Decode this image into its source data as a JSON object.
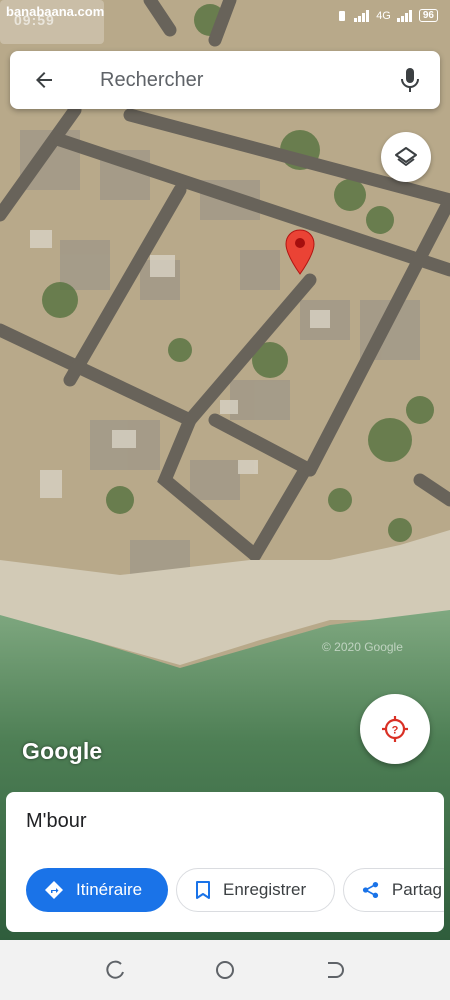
{
  "status_bar": {
    "time": "09:59",
    "network": "4G",
    "battery": "96",
    "watermark": "banabaana.com"
  },
  "search": {
    "placeholder": "Rechercher"
  },
  "map": {
    "copyright": "© 2020 Google",
    "logo": "Google",
    "icons": [
      "back-arrow-icon",
      "microphone-icon",
      "layers-icon",
      "map-pin-icon",
      "my-location-icon"
    ]
  },
  "place": {
    "title": "M'bour"
  },
  "actions": {
    "directions": "Itinéraire",
    "save": "Enregistrer",
    "share": "Partag"
  },
  "colors": {
    "accent": "#1a73e8",
    "pin": "#ea4335",
    "locate": "#d93025"
  }
}
